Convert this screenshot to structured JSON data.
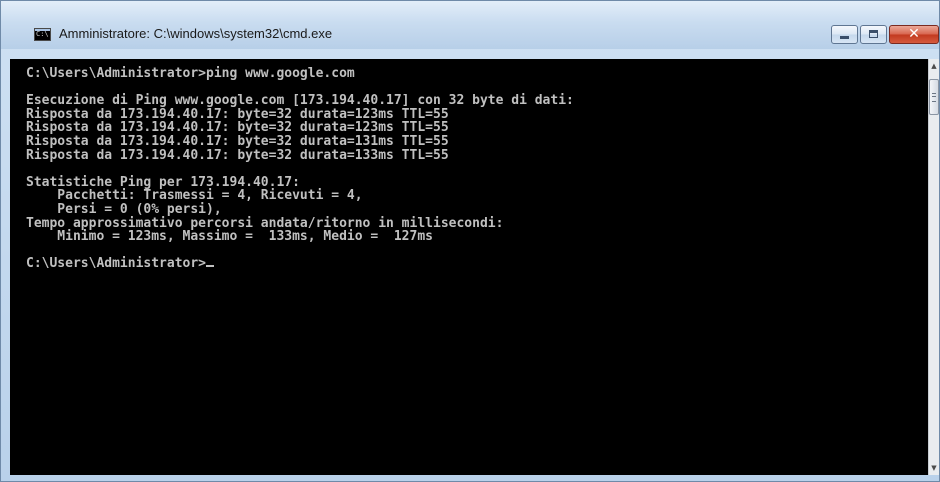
{
  "window": {
    "title": "Amministratore: C:\\windows\\system32\\cmd.exe",
    "icon": "console-icon",
    "icon_label": "C:\\",
    "controls": {
      "minimize": "minimize-icon",
      "maximize": "maximize-icon",
      "close_glyph": "✕"
    }
  },
  "console": {
    "text": "C:\\Users\\Administrator>ping www.google.com\n\nEsecuzione di Ping www.google.com [173.194.40.17] con 32 byte di dati:\nRisposta da 173.194.40.17: byte=32 durata=123ms TTL=55\nRisposta da 173.194.40.17: byte=32 durata=123ms TTL=55\nRisposta da 173.194.40.17: byte=32 durata=131ms TTL=55\nRisposta da 173.194.40.17: byte=32 durata=133ms TTL=55\n\nStatistiche Ping per 173.194.40.17:\n    Pacchetti: Trasmessi = 4, Ricevuti = 4,\n    Persi = 0 (0% persi),\nTempo approssimativo percorsi andata/ritorno in millisecondi:\n    Minimo = 123ms, Massimo =  133ms, Medio =  127ms\n\nC:\\Users\\Administrator>",
    "foreground": "#c0c0c0",
    "background": "#000000"
  },
  "scrollbar": {
    "up_glyph": "▲",
    "down_glyph": "▼"
  }
}
